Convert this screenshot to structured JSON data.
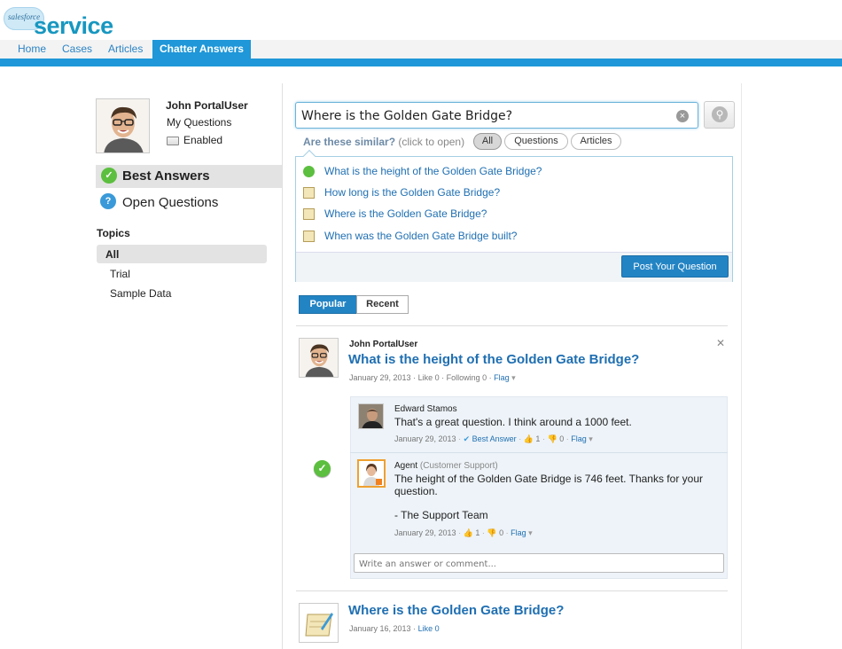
{
  "header": {
    "logo_small": "salesforce",
    "logo_text": "service cloud",
    "tabs": [
      {
        "label": "Home"
      },
      {
        "label": "Cases"
      },
      {
        "label": "Articles"
      },
      {
        "label": "Chatter Answers"
      }
    ]
  },
  "sidebar": {
    "user_name": "John PortalUser",
    "my_questions": "My Questions",
    "enabled": "Enabled",
    "best_answers": "Best Answers",
    "open_questions": "Open Questions",
    "topics_heading": "Topics",
    "topics": [
      {
        "label": "All"
      },
      {
        "label": "Trial"
      },
      {
        "label": "Sample Data"
      }
    ]
  },
  "search": {
    "value": "Where is the Golden Gate Bridge?",
    "similar_label": "Are these similar?",
    "similar_hint": "(click to open)",
    "filters": [
      {
        "label": "All"
      },
      {
        "label": "Questions"
      },
      {
        "label": "Articles"
      }
    ],
    "results": [
      {
        "text": "What is the height of the Golden Gate Bridge?",
        "icon": "answered-check-icon"
      },
      {
        "text": "How long is the Golden Gate Bridge?",
        "icon": "question-note-icon"
      },
      {
        "text": "Where is the Golden Gate Bridge?",
        "icon": "question-note-icon"
      },
      {
        "text": "When was the Golden Gate Bridge built?",
        "icon": "question-note-icon"
      }
    ],
    "post_button": "Post Your Question"
  },
  "feed_tabs": {
    "popular": "Popular",
    "recent": "Recent"
  },
  "feed": {
    "q1": {
      "author": "John PortalUser",
      "title": "What is the height of the Golden Gate Bridge?",
      "date": "January 29, 2013",
      "likes": "Like 0",
      "following": "Following 0",
      "flag": "Flag",
      "replies": [
        {
          "name": "Edward Stamos",
          "role": "",
          "body": "That's a great question. I think around a 1000 feet.",
          "date": "January 29, 2013",
          "best_answer": "Best Answer",
          "up": "1",
          "down": "0",
          "flag": "Flag"
        },
        {
          "name": "Agent",
          "role": "(Customer Support)",
          "body": "The height of the Golden Gate Bridge is 746 feet. Thanks for your question.",
          "signature": "- The Support Team",
          "date": "January 29, 2013",
          "up": "1",
          "down": "0",
          "flag": "Flag"
        }
      ],
      "comment_placeholder": "Write an answer or comment..."
    },
    "q2": {
      "title": "Where is the Golden Gate Bridge?",
      "date": "January 16, 2013",
      "like": "Like 0"
    }
  },
  "colors": {
    "brand": "#1f97d8",
    "link": "#1f6fb2",
    "best": "#5cbf3f"
  }
}
